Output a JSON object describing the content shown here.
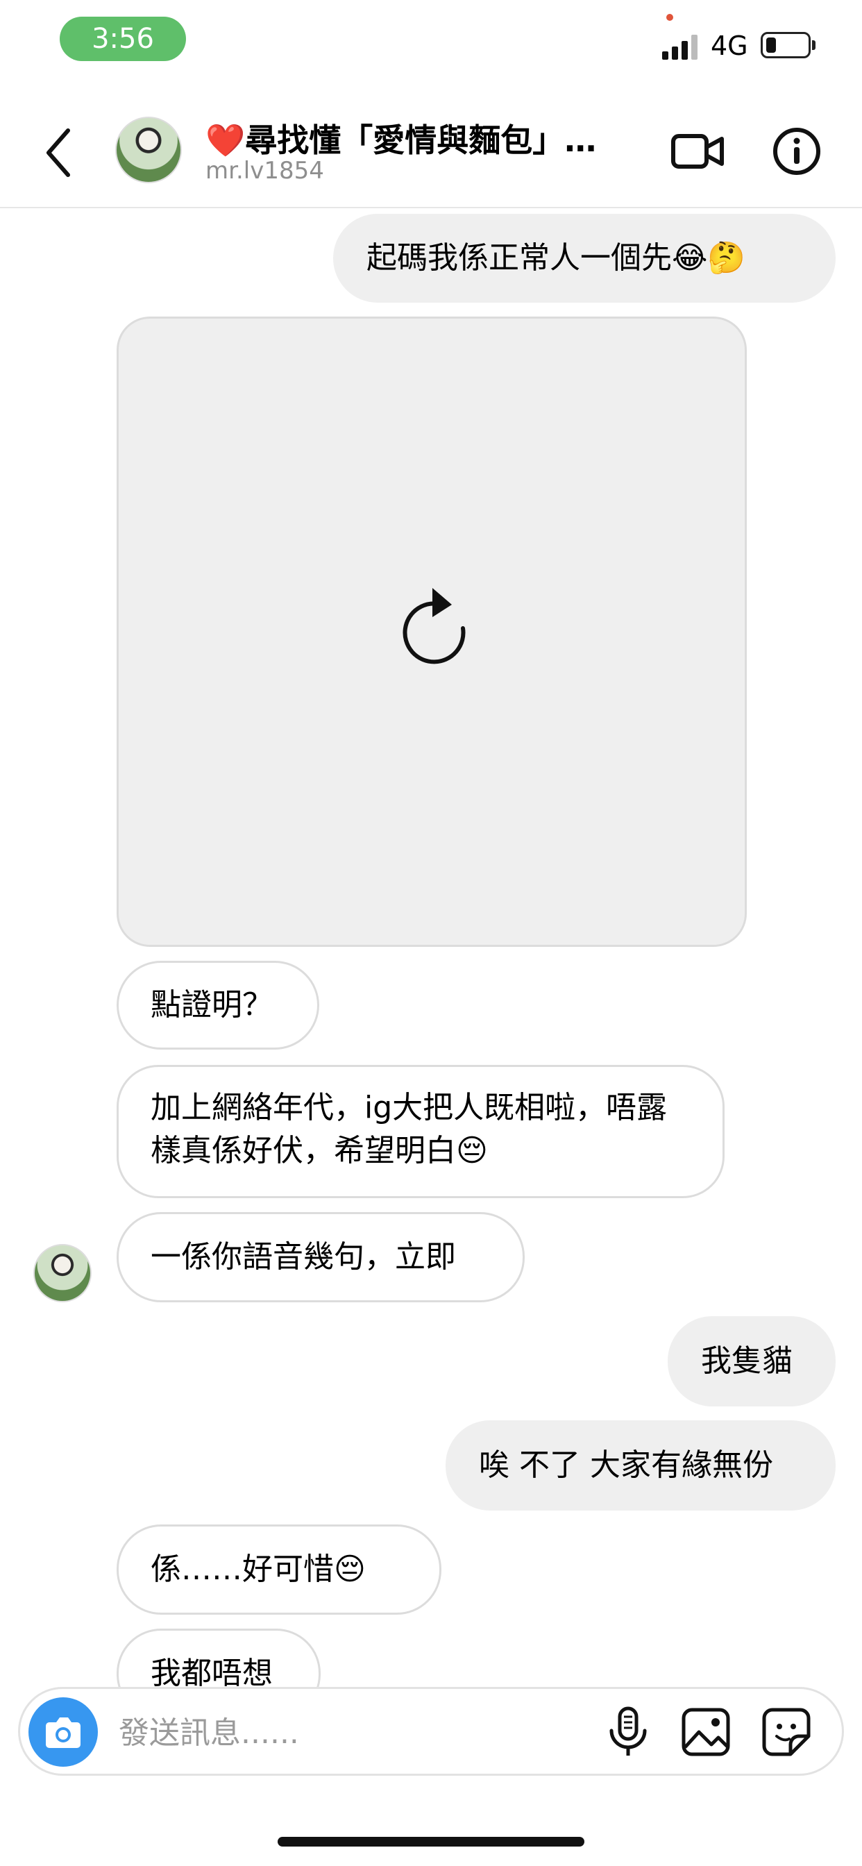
{
  "status_bar": {
    "time": "3:56",
    "network": "4G",
    "battery_level": 0.15,
    "colors": {
      "time_pill": "#5fbf6a"
    }
  },
  "header": {
    "title": "❤️尋找懂「愛情與麵包」…",
    "username": "mr.lv1854",
    "icons": [
      "chevron-left-icon",
      "video-camera-icon",
      "info-icon"
    ]
  },
  "messages": [
    {
      "direction": "sent",
      "text": "起碼我係正常人一個先😂🤔"
    },
    {
      "direction": "received",
      "type": "media",
      "state": "reload",
      "icon": "reload-icon"
    },
    {
      "direction": "received",
      "text": "點證明？"
    },
    {
      "direction": "received",
      "text": "加上網絡年代，ig大把人既相啦，唔露樣真係好伏，希望明白😔"
    },
    {
      "direction": "received",
      "text": "一係你語音幾句，立即"
    },
    {
      "direction": "sent",
      "text": "我隻貓"
    },
    {
      "direction": "sent",
      "text": "唉 不了 大家有緣無份"
    },
    {
      "direction": "received",
      "text": "係……好可惜😔"
    },
    {
      "direction": "received",
      "text": "我都唔想"
    }
  ],
  "composer": {
    "placeholder": "發送訊息......",
    "icons": [
      "camera-icon",
      "microphone-icon",
      "gallery-icon",
      "sticker-icon"
    ],
    "accent": "#3797f0"
  }
}
